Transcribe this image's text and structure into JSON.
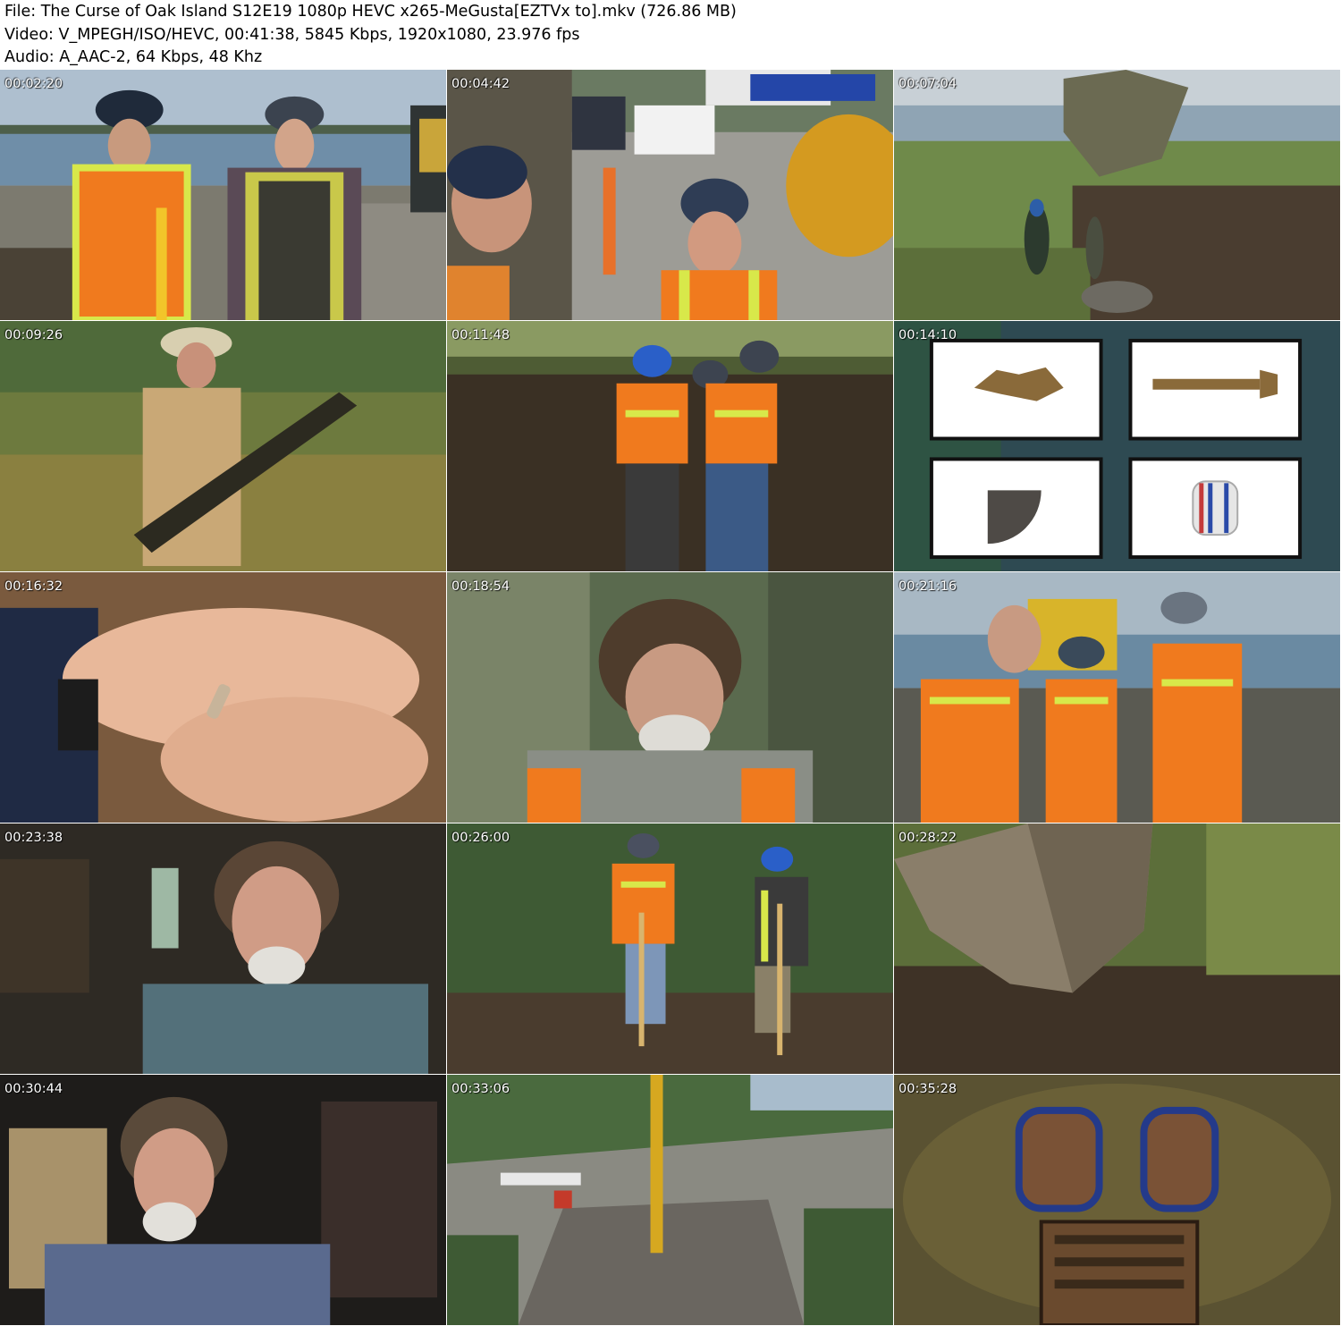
{
  "header": {
    "file_line": "File: The Curse of Oak Island S12E19 1080p HEVC x265-MeGusta[EZTVx to].mkv (726.86 MB)",
    "video_line": "Video: V_MPEGH/ISO/HEVC, 00:41:38, 5845 Kbps, 1920x1080, 23.976 fps",
    "audio_line": "Audio: A_AAC-2, 64 Kbps, 48 Khz"
  },
  "thumbnails": [
    {
      "timestamp": "00:02:20",
      "scene": "two-men-hardhats-shoreline"
    },
    {
      "timestamp": "00:04:42",
      "scene": "men-examining-artifact-parking-lot"
    },
    {
      "timestamp": "00:07:04",
      "scene": "excavator-bucket-grass-shore"
    },
    {
      "timestamp": "00:09:26",
      "scene": "archival-man-in-marsh"
    },
    {
      "timestamp": "00:11:48",
      "scene": "crew-digging-mud"
    },
    {
      "timestamp": "00:14:10",
      "scene": "four-artifacts-display"
    },
    {
      "timestamp": "00:16:32",
      "scene": "hand-holding-small-artifact"
    },
    {
      "timestamp": "00:18:54",
      "scene": "man-looking-down-forest"
    },
    {
      "timestamp": "00:21:16",
      "scene": "three-men-examining-find"
    },
    {
      "timestamp": "00:23:38",
      "scene": "interview-man-glasses"
    },
    {
      "timestamp": "00:26:00",
      "scene": "two-men-with-shovels-woods"
    },
    {
      "timestamp": "00:28:22",
      "scene": "excavator-bucket-closeup"
    },
    {
      "timestamp": "00:30:44",
      "scene": "man-reading-war-room"
    },
    {
      "timestamp": "00:33:06",
      "scene": "aerial-dig-site-crane"
    },
    {
      "timestamp": "00:35:28",
      "scene": "graphic-barrels-in-ground"
    }
  ],
  "colors": {
    "header_bg": "#ffffff",
    "header_text": "#000000",
    "stamp_text": "#ffffff",
    "safety_orange": "#f07a1e",
    "reflective_yellow": "#d8e84a"
  }
}
